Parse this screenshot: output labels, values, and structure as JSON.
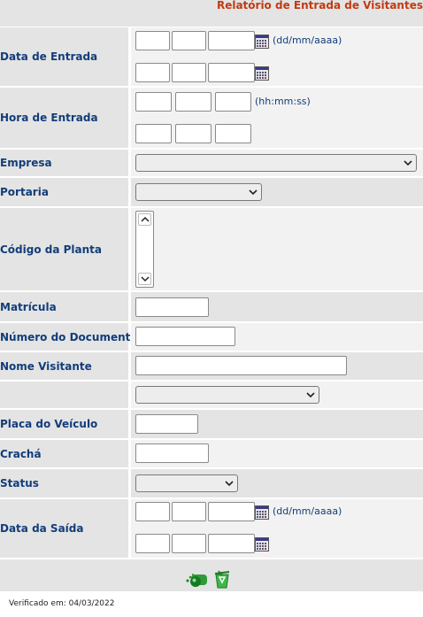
{
  "title": "Relatório de Entrada de Visitantes",
  "form": {
    "data_entrada": {
      "label": "Data de Entrada",
      "hint": "(dd/mm/aaaa)"
    },
    "hora_entrada": {
      "label": "Hora de Entrada",
      "hint": "(hh:mm:ss)"
    },
    "empresa": {
      "label": "Empresa"
    },
    "portaria": {
      "label": "Portaria"
    },
    "codigo_planta": {
      "label": "Código da Planta"
    },
    "matricula": {
      "label": "Matrícula"
    },
    "numero_documento": {
      "label": "Número do Documento"
    },
    "nome_visitante": {
      "label": "Nome Visitante"
    },
    "placa_veiculo": {
      "label": "Placa do Veículo"
    },
    "cracha": {
      "label": "Crachá"
    },
    "status": {
      "label": "Status"
    },
    "data_saida": {
      "label": "Data da Saída",
      "hint": "(dd/mm/aaaa)"
    }
  },
  "footer": {
    "verified": "Verificado em: 04/03/2022"
  },
  "icons": {
    "calendar": "calendar-icon",
    "search": "search-icon",
    "clear": "recycle-bin-icon",
    "chevron": "chevron-down-icon"
  },
  "colors": {
    "title": "#c23a12",
    "label": "#123d7a",
    "label_bg": "#e4e4e4",
    "field_bg": "#f2f2f2"
  }
}
